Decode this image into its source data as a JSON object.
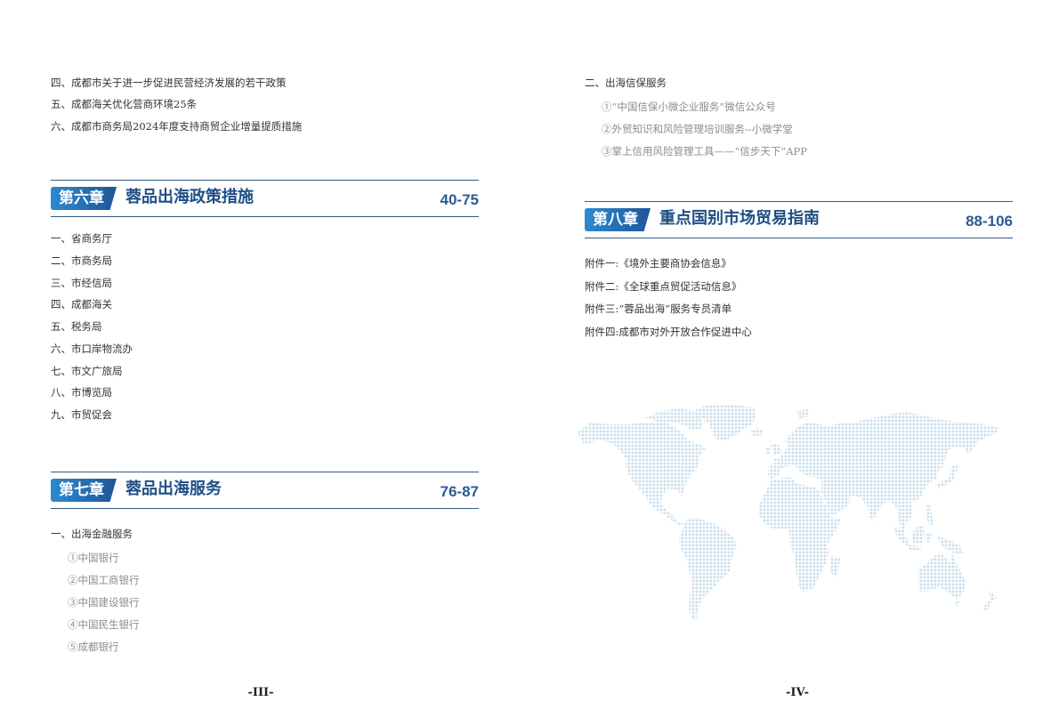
{
  "left_page": {
    "intro_items": [
      "四、成都市关于进一步促进民营经济发展的若干政策",
      "五、成都海关优化营商环境25条",
      "六、成都市商务局2024年度支持商贸企业增量提质措施"
    ],
    "chapter_6": {
      "badge": "第六章",
      "title": "蓉品出海政策措施",
      "pages": "40-75",
      "items": [
        "一、省商务厅",
        "二、市商务局",
        "三、市经信局",
        "四、成都海关",
        "五、税务局",
        "六、市口岸物流办",
        "七、市文广旅局",
        "八、市博览局",
        "九、市贸促会"
      ]
    },
    "chapter_7": {
      "badge": "第七章",
      "title": "蓉品出海服务",
      "pages": "76-87",
      "section": "一、出海金融服务",
      "subitems": [
        "①中国银行",
        "②中国工商银行",
        "③中国建设银行",
        "④中国民生银行",
        "⑤成都银行"
      ]
    },
    "page_number": "-III-"
  },
  "right_page": {
    "section": "二、出海信保服务",
    "subitems": [
      "①“中国信保小微企业服务”微信公众号",
      "②外贸知识和风险管理培训服务--小微学堂",
      "③掌上信用风险管理工具——“信步天下”APP"
    ],
    "chapter_8": {
      "badge": "第八章",
      "title": "重点国别市场贸易指南",
      "pages": "88-106"
    },
    "appendices": [
      "附件一:《境外主要商协会信息》",
      "附件二:《全球重点贸促活动信息》",
      "附件三:“蓉品出海”服务专员清单",
      "附件四:成都市对外开放合作促进中心"
    ],
    "page_number": "-IV-"
  },
  "decor": {
    "map_icon": "dotted-world-map-icon"
  },
  "colors": {
    "accent": "#1f4e85",
    "rule": "#365a87",
    "badge_from": "#2d8ad0",
    "badge_to": "#1d5697",
    "pages": "#2a5b96",
    "subitem_text": "#8c8c8c",
    "body_text": "#333333",
    "map_dots": "#c9deec"
  }
}
